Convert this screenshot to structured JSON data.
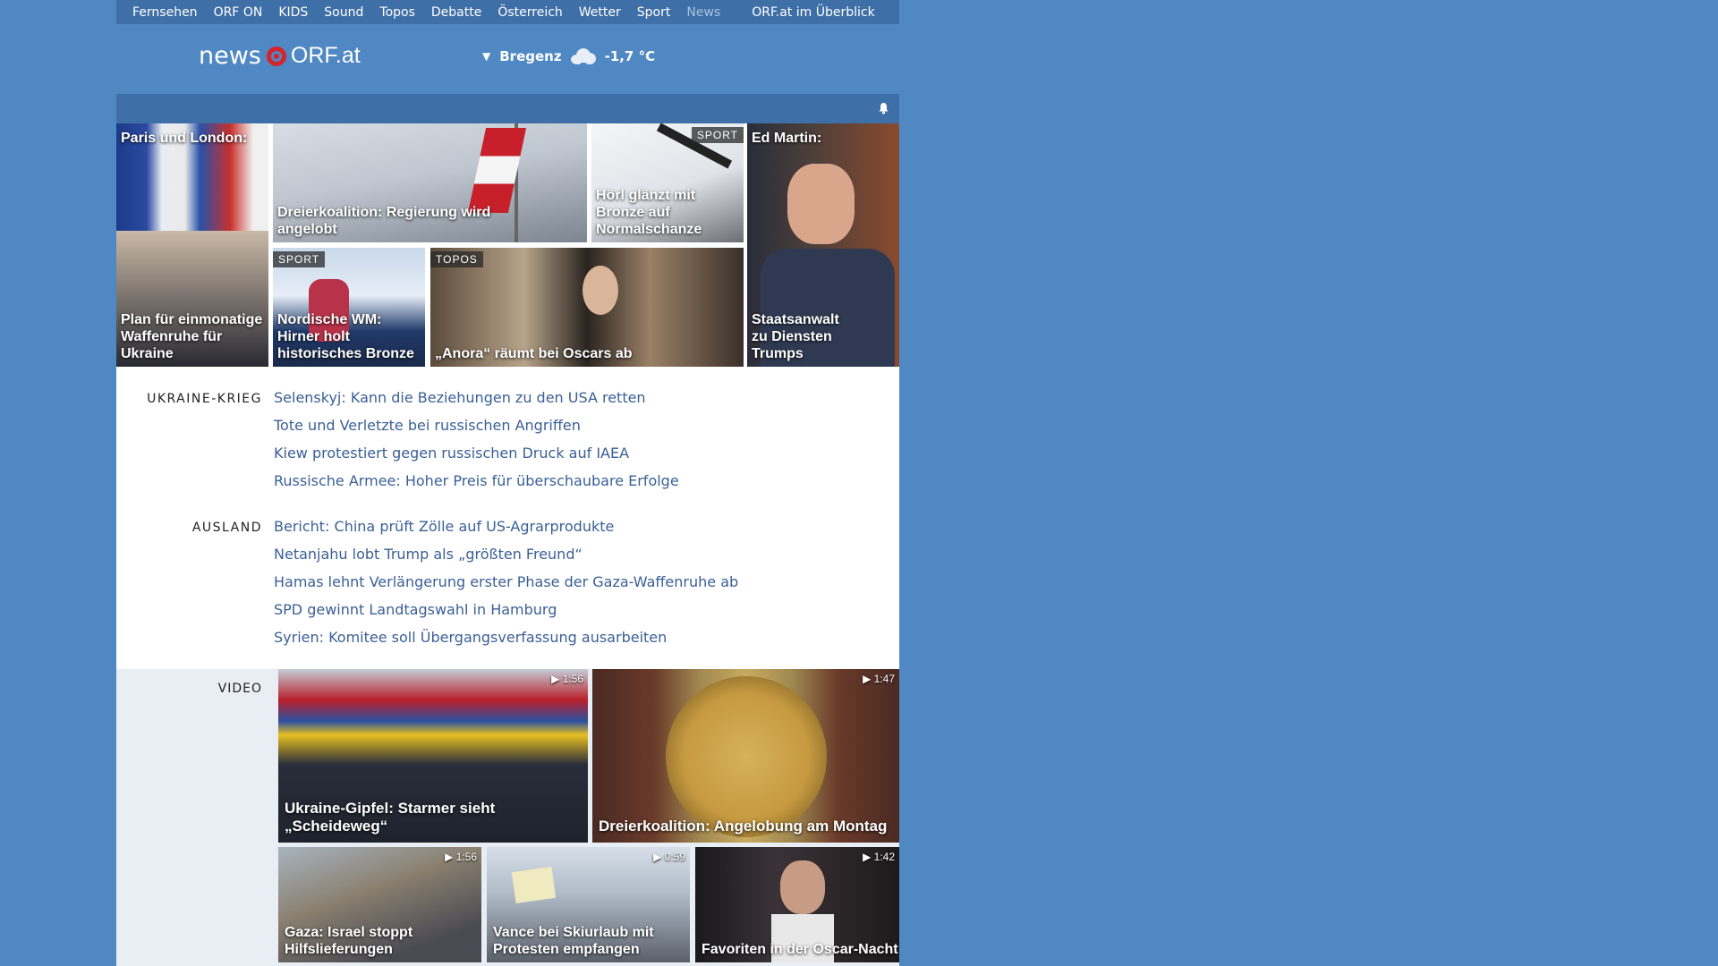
{
  "nav": {
    "items": [
      "Fernsehen",
      "ORF ON",
      "KIDS",
      "Sound",
      "Topos",
      "Debatte",
      "Österreich",
      "Wetter",
      "Sport",
      "News"
    ],
    "overview": "ORF.at im Überblick"
  },
  "logo": {
    "news": "news",
    "orf": "ORF.at"
  },
  "weather": {
    "location": "Bregenz",
    "temperature": "-1,7 °C",
    "icon": "cloud-icon"
  },
  "teasers": [
    {
      "caption_top": "Paris und London:",
      "caption": "Plan für einmonatige Waffenruhe für Ukraine"
    },
    {
      "caption": "Dreierkoalition: Regierung wird angelobt"
    },
    {
      "tag": "SPORT",
      "caption": "Hörl glänzt mit Bronze auf Normalschanze"
    },
    {
      "caption_top": "Ed Martin:",
      "caption": "Staatsanwalt zu Diensten Trumps"
    },
    {
      "tag": "SPORT",
      "caption": "Nordische WM: Hirner holt historisches Bronze"
    },
    {
      "tag": "TOPOS",
      "caption": "„Anora“ räumt bei Oscars ab"
    }
  ],
  "sections": [
    {
      "label": "UKRAINE-KRIEG",
      "stories": [
        "Selenskyj: Kann die Beziehungen zu den USA retten",
        "Tote und Verletzte bei russischen Angriffen",
        "Kiew protestiert gegen russischen Druck auf IAEA",
        "Russische Armee: Hoher Preis für überschaubare Erfolge"
      ]
    },
    {
      "label": "AUSLAND",
      "stories": [
        "Bericht: China prüft Zölle auf US-Agrarprodukte",
        "Netanjahu lobt Trump als „größten Freund“",
        "Hamas lehnt Verlängerung erster Phase der Gaza-Waffenruhe ab",
        "SPD gewinnt Landtagswahl in Hamburg",
        "Syrien: Komitee soll Übergangsverfassung ausarbeiten"
      ]
    }
  ],
  "video": {
    "label": "VIDEO",
    "items": [
      {
        "caption": "Ukraine-Gipfel: Starmer sieht „Scheideweg“",
        "duration": "▶ 1:56"
      },
      {
        "caption": "Dreierkoalition: Angelobung am Montag",
        "duration": "▶ 1:47"
      },
      {
        "caption": "Gaza: Israel stoppt Hilfslieferungen",
        "duration": "▶ 1:56"
      },
      {
        "caption": "Vance bei Skiurlaub mit Protesten empfangen",
        "duration": "▶ 0:59"
      },
      {
        "caption": "Favoriten in der Oscar-Nacht",
        "duration": "▶ 1:42"
      }
    ]
  }
}
